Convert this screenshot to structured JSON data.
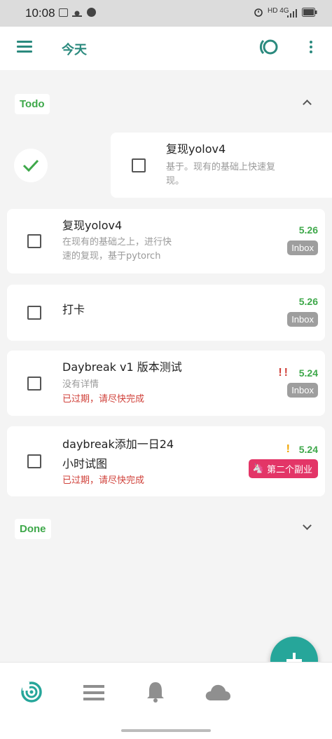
{
  "status_bar": {
    "time": "10:08",
    "right": "HD 4G"
  },
  "app_bar": {
    "title": "今天"
  },
  "todo_section": {
    "label": "Todo"
  },
  "swiped_task": {
    "title": "复现yolov4",
    "desc_line1": "基于。现有的基础上快速复",
    "desc_line2": "现。"
  },
  "tasks": [
    {
      "title": "复现yolov4",
      "desc_line1": "在现有的基础之上，进行快",
      "desc_line2": "速的复现，基于pytorch",
      "date": "5.26",
      "badge": "Inbox"
    },
    {
      "title": "打卡",
      "date": "5.26",
      "badge": "Inbox"
    },
    {
      "title": "Daybreak v1 版本测试",
      "desc": "没有详情",
      "overdue": "已过期，请尽快完成",
      "priority": "!!",
      "date": "5.24",
      "badge": "Inbox"
    },
    {
      "title_line1": "daybreak添加一日24",
      "title_line2": "小时试图",
      "overdue": "已过期，请尽快完成",
      "priority": "!",
      "date": "5.24",
      "badge": "第二个副业"
    }
  ],
  "done_section": {
    "label": "Done"
  },
  "colors": {
    "accent": "#2b8a7e",
    "fab": "#26a69a",
    "date_green": "#3ea84a",
    "overdue": "#d0413a",
    "tag": "#e33567"
  },
  "icons": {
    "menu": "hamburger-icon",
    "focus": "focus-ring-icon",
    "more": "more-vert-icon",
    "nav": [
      "today-target-icon",
      "list-icon",
      "bell-icon",
      "cloud-icon"
    ],
    "fab": "plus-icon"
  }
}
